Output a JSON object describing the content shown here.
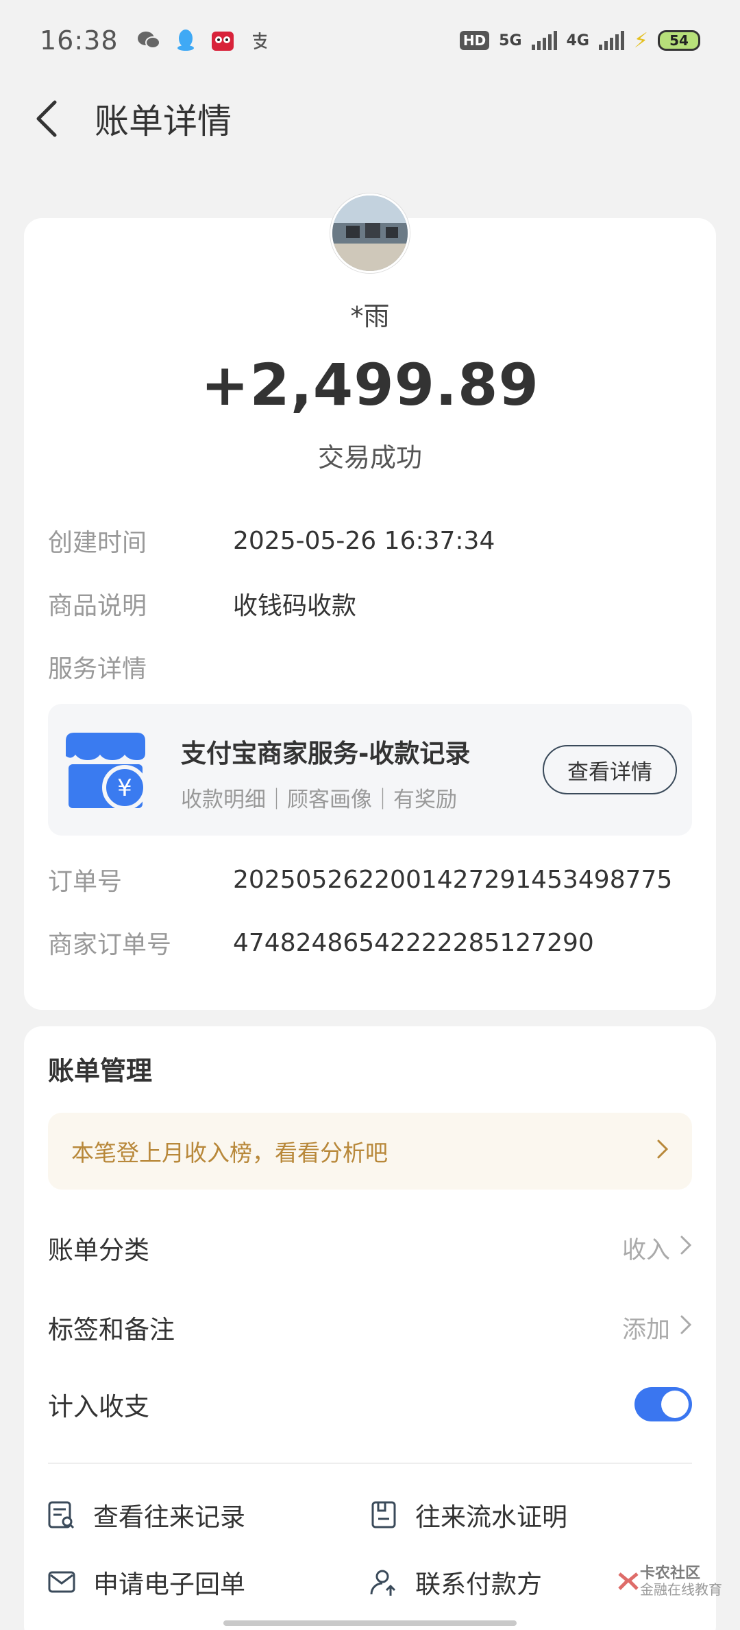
{
  "status_bar": {
    "time": "16:38",
    "app_icons": [
      "wechat-icon",
      "qq-icon",
      "tmall-icon",
      "alipay-icon"
    ],
    "hd_label": "HD",
    "network_1": "5G",
    "network_2": "4G",
    "battery": "54"
  },
  "header": {
    "title": "账单详情"
  },
  "transaction": {
    "payer_name": "*雨",
    "amount": "+2,499.89",
    "status": "交易成功"
  },
  "details": {
    "created_time_label": "创建时间",
    "created_time_value": "2025-05-26 16:37:34",
    "product_label": "商品说明",
    "product_value": "收钱码收款",
    "service_label": "服务详情",
    "order_no_label": "订单号",
    "order_no_value": "2025052622001427291453498775",
    "merchant_order_label": "商家订单号",
    "merchant_order_value": "47482486542222285127290"
  },
  "service": {
    "title": "支付宝商家服务-收款记录",
    "subtitle": "收款明细｜顾客画像｜有奖励",
    "button": "查看详情",
    "currency_symbol": "¥"
  },
  "manage": {
    "title": "账单管理",
    "banner": "本笔登上月收入榜，看看分析吧",
    "category_label": "账单分类",
    "category_value": "收入",
    "tags_label": "标签和备注",
    "tags_value": "添加",
    "count_label": "计入收支",
    "count_enabled": true
  },
  "actions": {
    "history": "查看往来记录",
    "proof": "往来流水证明",
    "receipt": "申请电子回单",
    "contact": "联系付款方"
  },
  "watermark": {
    "name": "卡农社区",
    "sub": "金融在线教育"
  },
  "colors": {
    "accent": "#3a76f0",
    "banner_text": "#b8883a",
    "label_gray": "#999999"
  }
}
